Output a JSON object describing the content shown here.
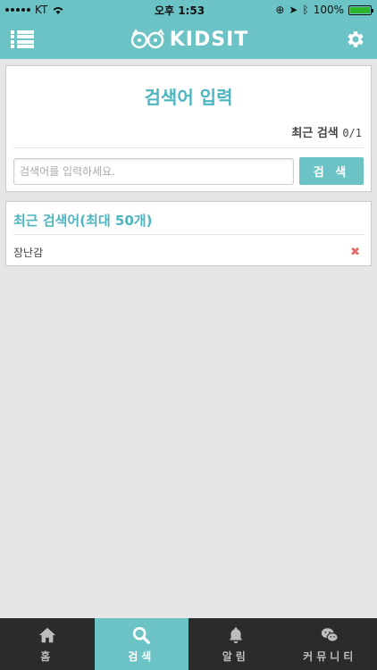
{
  "status_bar": {
    "carrier": "KT",
    "time": "오후 1:53",
    "battery": "100%"
  },
  "header": {
    "logo_text": "KIDSIT"
  },
  "search_card": {
    "title": "검색어 입력",
    "recent_label": "최근 검색",
    "recent_count": "0/1",
    "input_placeholder": "검색어를 입력하세요.",
    "input_value": "",
    "button_label": "검 색"
  },
  "recent_card": {
    "title": "최근 검색어(최대 50개)",
    "items": [
      {
        "label": "장난감",
        "delete_glyph": "✖"
      }
    ]
  },
  "tab_bar": {
    "tabs": [
      {
        "label": "홈",
        "icon": "home-icon",
        "active": false
      },
      {
        "label": "검색",
        "icon": "search-icon",
        "active": true
      },
      {
        "label": "알림",
        "icon": "bell-icon",
        "active": false
      },
      {
        "label": "커뮤니티",
        "icon": "chat-icon",
        "active": false
      }
    ]
  },
  "colors": {
    "accent": "#6cc3c6",
    "title_text": "#4db5c0",
    "tab_bar_bg": "#2b2b2b",
    "delete": "#e46b6b"
  }
}
